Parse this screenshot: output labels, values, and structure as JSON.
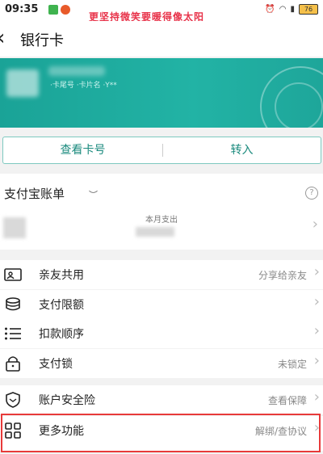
{
  "status_bar": {
    "time": "09:35",
    "banner": "更坚持微笑要暖得像太阳",
    "battery": "76"
  },
  "header": {
    "back_icon": "chevron-left-icon",
    "title": "银行卡"
  },
  "card": {
    "info": "·卡尾号  ·卡片名  ·Y**"
  },
  "actions": {
    "view_card_number": "查看卡号",
    "transfer": "转入"
  },
  "bill": {
    "title": "支付宝账单",
    "month_label": "本月支出"
  },
  "menu": [
    {
      "label": "亲友共用",
      "value": "分享给亲友",
      "icon": "family-card-icon"
    },
    {
      "label": "支付限额",
      "value": "",
      "icon": "coin-stack-icon"
    },
    {
      "label": "扣款顺序",
      "value": "",
      "icon": "list-order-icon"
    },
    {
      "label": "支付锁",
      "value": "未锁定",
      "icon": "lock-icon"
    },
    {
      "label": "账户安全险",
      "value": "查看保障",
      "icon": "shield-icon"
    },
    {
      "label": "更多功能",
      "value": "解绑/查协议",
      "icon": "grid-icon"
    }
  ],
  "colors": {
    "accent": "#1aa397",
    "highlight": "#e83a3a"
  }
}
